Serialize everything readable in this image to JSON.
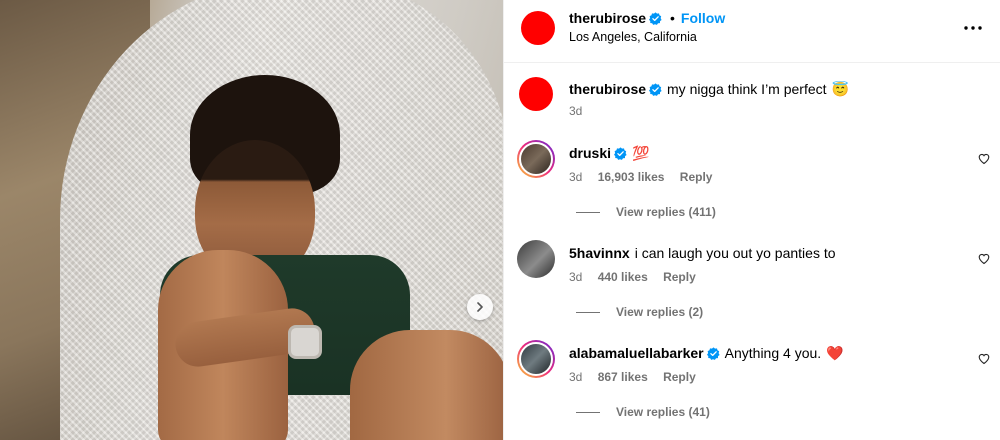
{
  "post": {
    "author": "therubirose",
    "separator": "•",
    "follow_label": "Follow",
    "location": "Los Angeles, California",
    "more_icon": "more-horizontal-icon",
    "caption_author": "therubirose",
    "caption_text": "my nigga think I’m perfect",
    "caption_emoji": "😇",
    "caption_time": "3d",
    "avatar_color": "#ff0000"
  },
  "comments": [
    {
      "username": "druski",
      "verified": true,
      "text": "",
      "emoji": "💯",
      "time": "3d",
      "likes": "16,903 likes",
      "reply": "Reply",
      "view_replies": "View replies (411)"
    },
    {
      "username": "5havinnx",
      "verified": false,
      "text": "i can laugh you out yo panties to",
      "emoji": "",
      "time": "3d",
      "likes": "440 likes",
      "reply": "Reply",
      "view_replies": "View replies (2)"
    },
    {
      "username": "alabamaluellabarker",
      "verified": true,
      "text": "Anything 4 you.",
      "emoji": "❤️",
      "time": "3d",
      "likes": "867 likes",
      "reply": "Reply",
      "view_replies": "View replies (41)"
    }
  ],
  "colors": {
    "accent": "#0095f6",
    "muted": "#737373",
    "verified": "#0095f6"
  }
}
